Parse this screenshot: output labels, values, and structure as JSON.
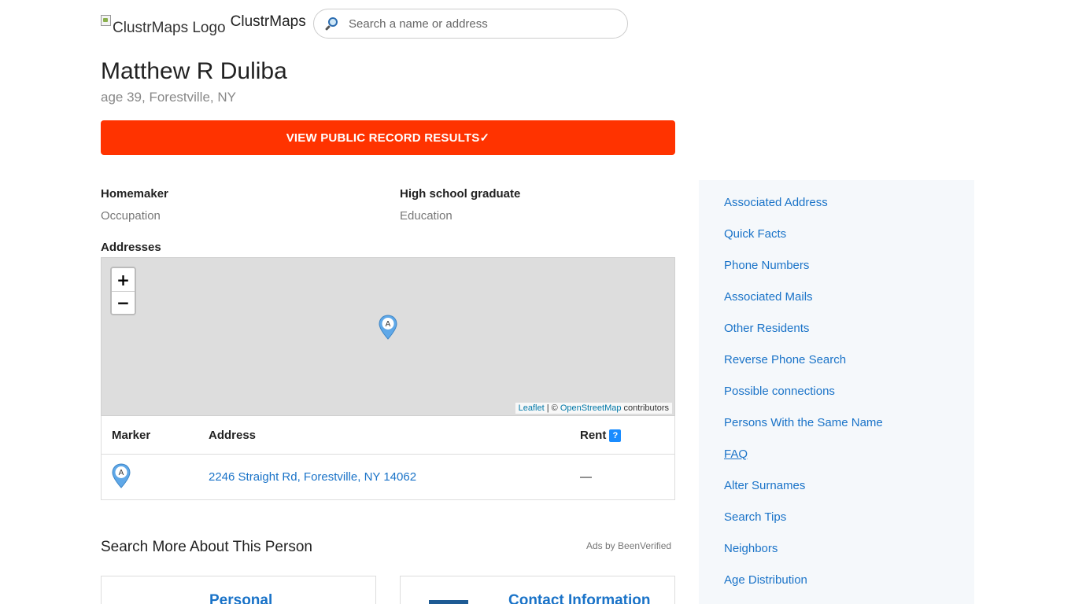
{
  "header": {
    "logo_alt": "ClustrMaps Logo",
    "logo_text": "ClustrMaps",
    "search_placeholder": "Search a name or address"
  },
  "person": {
    "name": "Matthew R Duliba",
    "subline": "age 39, Forestville, NY"
  },
  "cta_label": "VIEW PUBLIC RECORD RESULTS✓",
  "facts": [
    {
      "value": "Homemaker",
      "key": "Occupation"
    },
    {
      "value": "High school graduate",
      "key": "Education"
    }
  ],
  "addresses": {
    "label": "Addresses",
    "map": {
      "zoom_in": "+",
      "zoom_out": "−",
      "marker_letter": "A",
      "attribution_leaflet": "Leaflet",
      "attribution_sep": " | © ",
      "attribution_osm": "OpenStreetMap",
      "attribution_tail": " contributors"
    },
    "table": {
      "headers": {
        "marker": "Marker",
        "address": "Address",
        "rent": "Rent",
        "rent_help": "?"
      },
      "rows": [
        {
          "marker": "A",
          "address": "2246 Straight Rd, Forestville, NY 14062",
          "rent": "—"
        }
      ]
    }
  },
  "search_more": {
    "title": "Search More About This Person",
    "ads_by": "Ads by BeenVerified",
    "cards": [
      {
        "title": "Personal"
      },
      {
        "title": "Contact Information"
      }
    ]
  },
  "sidebar": {
    "items": [
      {
        "label": "Associated Address"
      },
      {
        "label": "Quick Facts"
      },
      {
        "label": "Phone Numbers"
      },
      {
        "label": "Associated Mails"
      },
      {
        "label": "Other Residents"
      },
      {
        "label": "Reverse Phone Search"
      },
      {
        "label": "Possible connections"
      },
      {
        "label": "Persons With the Same Name"
      },
      {
        "label": "FAQ"
      },
      {
        "label": "Alter Surnames"
      },
      {
        "label": "Search Tips"
      },
      {
        "label": "Neighbors"
      },
      {
        "label": "Age Distribution"
      }
    ]
  },
  "colors": {
    "cta": "#ff3300",
    "link": "#1a73c8",
    "sidebar_bg": "#f5f8fb",
    "map_bg": "#dddddd",
    "marker": "#5fa8e8"
  }
}
